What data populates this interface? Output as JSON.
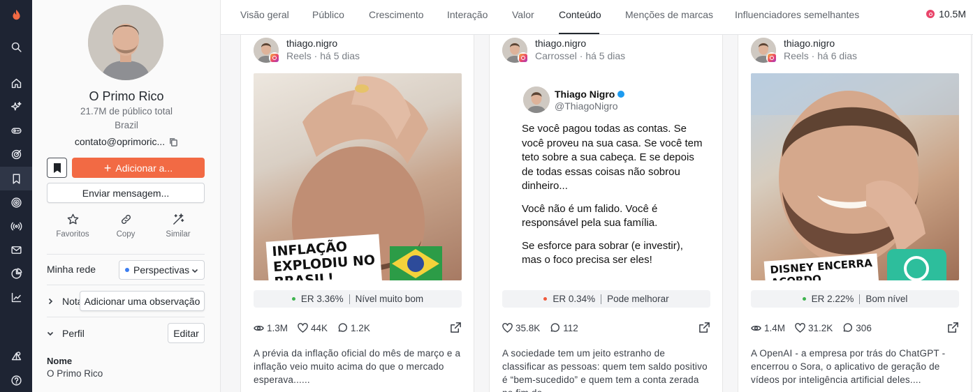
{
  "nav": {
    "items": [
      "logo",
      "search",
      "home",
      "discover",
      "campaigns",
      "tracking",
      "saved",
      "audience",
      "broadcast",
      "mail",
      "analytics",
      "reports",
      "integrations",
      "help"
    ]
  },
  "profile": {
    "name": "O Primo Rico",
    "audience": "21.7M de público total",
    "country": "Brazil",
    "email": "contato@oprimoric...",
    "add_label": "Adicionar a...",
    "message_label": "Enviar mensagem...",
    "actions": {
      "favorites": "Favoritos",
      "copy": "Copy",
      "similar": "Similar"
    },
    "network_label": "Minha rede",
    "network_value": "Perspectivas",
    "notes_label": "Notas",
    "notes_button": "Adicionar uma observação",
    "profile_label": "Perfil",
    "edit_label": "Editar",
    "field_name_label": "Nome",
    "field_name_value": "O Primo Rico"
  },
  "tabs": [
    "Visão geral",
    "Público",
    "Crescimento",
    "Interação",
    "Valor",
    "Conteúdo",
    "Menções de marcas",
    "Influenciadores semelhantes"
  ],
  "active_tab": "Conteúdo",
  "followers": "10.5M",
  "posts": [
    {
      "user": "thiago.nigro",
      "meta": "Reels · há 5 dias",
      "media_text": [
        "INFLAÇÃO",
        "EXPLODIU NO",
        "BRASIL!"
      ],
      "er": "ER 3.36%",
      "er_level": "Nível muito bom",
      "er_color": "#3fb34f",
      "views": "1.3M",
      "likes": "44K",
      "comments": "1.2K",
      "caption": "A prévia da inflação oficial do mês de março e a inflação veio muito acima do que o mercado esperava......"
    },
    {
      "user": "thiago.nigro",
      "meta": "Carrossel · há 5 dias",
      "tweet": {
        "name": "Thiago Nigro",
        "handle": "@ThiagoNigro",
        "p1": "Se você pagou todas as contas. Se você proveu na sua casa. Se você tem teto sobre a sua cabeça. E se depois de todas essas coisas não sobrou dinheiro...",
        "p2": "Você não é um falido. Você é responsável pela sua família.",
        "p3": "Se esforce para sobrar (e investir), mas o foco precisa ser eles!"
      },
      "er": "ER 0.34%",
      "er_level": "Pode melhorar",
      "er_color": "#f05a3c",
      "likes": "35.8K",
      "comments": "112",
      "caption": "A sociedade tem um jeito estranho de classificar as pessoas: quem tem saldo positivo é “bem-sucedido” e quem tem a conta zerada no fim do..."
    },
    {
      "user": "thiago.nigro",
      "meta": "Reels · há 6 dias",
      "media_text": [
        "DISNEY ENCERRA",
        "ACORDO"
      ],
      "er": "ER 2.22%",
      "er_level": "Bom nível",
      "er_color": "#3fb34f",
      "views": "1.4M",
      "likes": "31.2K",
      "comments": "306",
      "caption": "A OpenAI - a empresa por trás do ChatGPT - encerrou o Sora, o aplicativo de geração de vídeos por inteligência artificial deles...."
    }
  ]
}
